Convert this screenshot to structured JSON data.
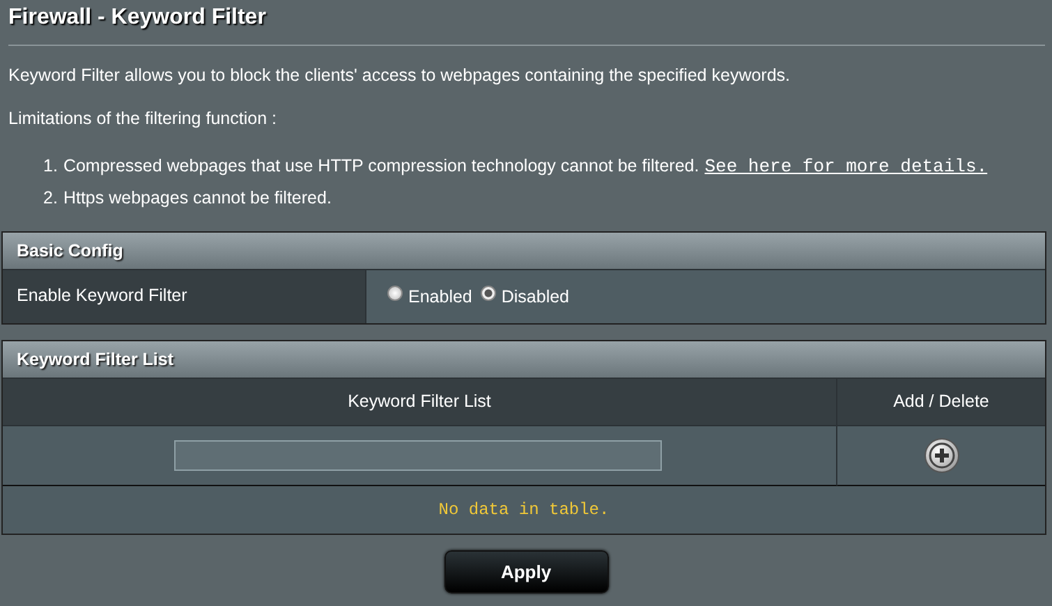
{
  "title": "Firewall - Keyword Filter",
  "description": "Keyword Filter allows you to block the clients' access to webpages containing the specified keywords.",
  "limitations_label": "Limitations of the filtering function :",
  "limitations": [
    {
      "number": "1.",
      "text": "Compressed webpages that use HTTP compression technology cannot be filtered.",
      "link": "See here for more details."
    },
    {
      "number": "2.",
      "text": "Https webpages cannot be filtered."
    }
  ],
  "basic_config": {
    "header": "Basic Config",
    "rows": [
      {
        "label": "Enable Keyword Filter",
        "options": [
          {
            "label": "Enabled",
            "selected": false
          },
          {
            "label": "Disabled",
            "selected": true
          }
        ]
      }
    ]
  },
  "keyword_list": {
    "header": "Keyword Filter List",
    "columns": [
      "Keyword Filter List",
      "Add / Delete"
    ],
    "empty_message": "No data in table."
  },
  "buttons": [
    "Apply"
  ]
}
